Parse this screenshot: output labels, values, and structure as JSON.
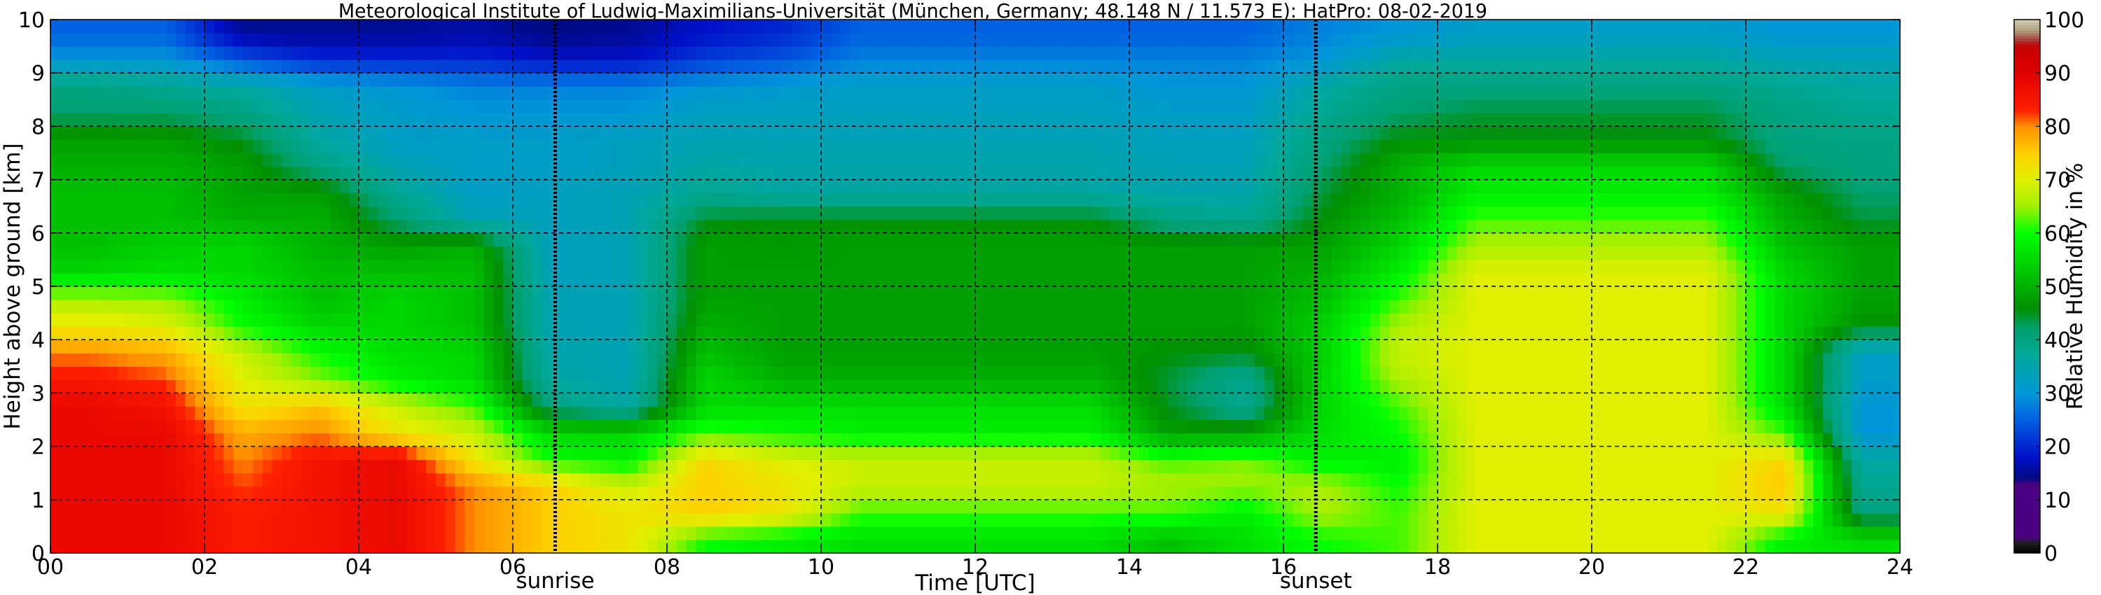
{
  "chart_data": {
    "type": "heatmap",
    "title": "Meteorological Institute of Ludwig-Maximilians-Universität (München, Germany; 48.148 N / 11.573 E):    HatPro: 08-02-2019",
    "xlabel": "Time [UTC]",
    "ylabel": "Height above ground [km]",
    "xlim": [
      0,
      24
    ],
    "ylim": [
      0,
      10
    ],
    "x_tick_labels": [
      "00",
      "02",
      "04",
      "06",
      "08",
      "10",
      "12",
      "14",
      "16",
      "18",
      "20",
      "22",
      "24"
    ],
    "y_tick_labels": [
      "0",
      "1",
      "2",
      "3",
      "4",
      "5",
      "6",
      "7",
      "8",
      "9",
      "10"
    ],
    "grid": true,
    "annotations": [
      {
        "text": "sunrise",
        "time": 6.55
      },
      {
        "text": "sunset",
        "time": 16.42
      }
    ],
    "colorbar": {
      "label": "Relative Humidity in %",
      "range": [
        0,
        100
      ],
      "tick_labels": [
        "0",
        "10",
        "20",
        "30",
        "40",
        "50",
        "60",
        "70",
        "80",
        "90",
        "100"
      ],
      "stops": [
        [
          0,
          "#000000"
        ],
        [
          2,
          "#202020"
        ],
        [
          3,
          "#4b0082"
        ],
        [
          13,
          "#4b0082"
        ],
        [
          14,
          "#000a80"
        ],
        [
          18,
          "#0010c8"
        ],
        [
          25,
          "#0060e0"
        ],
        [
          30,
          "#0098d8"
        ],
        [
          37,
          "#00a898"
        ],
        [
          42,
          "#00a070"
        ],
        [
          46,
          "#009000"
        ],
        [
          52,
          "#00c000"
        ],
        [
          60,
          "#00ff00"
        ],
        [
          65,
          "#a0f000"
        ],
        [
          70,
          "#e0f000"
        ],
        [
          75,
          "#ffd000"
        ],
        [
          80,
          "#ff9000"
        ],
        [
          83,
          "#ff2000"
        ],
        [
          90,
          "#e00000"
        ],
        [
          95,
          "#c80000"
        ],
        [
          96,
          "#a83030"
        ],
        [
          98,
          "#b0a080"
        ],
        [
          100,
          "#d0d0b0"
        ]
      ]
    },
    "time_centers_utc": [
      0.5,
      1.5,
      2.5,
      3.5,
      4.5,
      5.5,
      6.5,
      7.5,
      8.5,
      9.5,
      10.5,
      11.5,
      12.5,
      13.5,
      14.5,
      15.5,
      16.5,
      17.5,
      18.5,
      19.5,
      20.5,
      21.5,
      22.5,
      23.5
    ],
    "height_centers_km": [
      0.25,
      0.75,
      1.25,
      1.75,
      2.25,
      2.75,
      3.25,
      3.75,
      4.25,
      4.75,
      5.25,
      5.75,
      6.25,
      6.75,
      7.25,
      7.75,
      8.25,
      8.75,
      9.25,
      9.75
    ],
    "rh_profiles_percent": [
      [
        88,
        88,
        88,
        88,
        88,
        88,
        85,
        80,
        72,
        66,
        55,
        52,
        52,
        52,
        50,
        48,
        42,
        40,
        30,
        25
      ],
      [
        88,
        88,
        88,
        88,
        88,
        86,
        82,
        78,
        70,
        65,
        56,
        54,
        52,
        52,
        50,
        48,
        42,
        38,
        30,
        25
      ],
      [
        84,
        84,
        82,
        80,
        78,
        72,
        70,
        68,
        60,
        58,
        55,
        55,
        50,
        48,
        48,
        45,
        40,
        36,
        24,
        15
      ],
      [
        86,
        86,
        86,
        86,
        80,
        76,
        64,
        60,
        55,
        52,
        52,
        50,
        50,
        48,
        40,
        36,
        34,
        32,
        20,
        15
      ],
      [
        88,
        88,
        88,
        88,
        72,
        68,
        58,
        56,
        55,
        55,
        52,
        48,
        42,
        38,
        34,
        32,
        32,
        30,
        20,
        15
      ],
      [
        80,
        80,
        80,
        72,
        68,
        62,
        55,
        55,
        52,
        52,
        52,
        50,
        34,
        32,
        32,
        32,
        30,
        28,
        20,
        16
      ],
      [
        75,
        75,
        75,
        60,
        55,
        40,
        36,
        35,
        34,
        34,
        33,
        33,
        33,
        33,
        32,
        32,
        30,
        28,
        18,
        14
      ],
      [
        72,
        72,
        68,
        58,
        55,
        36,
        34,
        34,
        34,
        34,
        34,
        34,
        34,
        34,
        33,
        33,
        30,
        28,
        18,
        15
      ],
      [
        60,
        75,
        75,
        74,
        62,
        55,
        55,
        52,
        50,
        48,
        48,
        48,
        45,
        38,
        36,
        34,
        33,
        30,
        22,
        18
      ],
      [
        58,
        72,
        72,
        70,
        60,
        56,
        50,
        48,
        48,
        48,
        48,
        47,
        46,
        36,
        35,
        34,
        33,
        31,
        24,
        20
      ],
      [
        56,
        62,
        68,
        68,
        58,
        56,
        50,
        48,
        48,
        48,
        48,
        48,
        46,
        36,
        35,
        34,
        33,
        32,
        28,
        25
      ],
      [
        56,
        62,
        68,
        68,
        58,
        56,
        50,
        48,
        48,
        48,
        48,
        48,
        46,
        36,
        35,
        34,
        33,
        32,
        28,
        25
      ],
      [
        56,
        62,
        68,
        68,
        58,
        56,
        50,
        48,
        48,
        48,
        48,
        48,
        46,
        36,
        35,
        34,
        33,
        32,
        28,
        25
      ],
      [
        56,
        62,
        68,
        68,
        58,
        56,
        50,
        48,
        48,
        48,
        48,
        48,
        46,
        36,
        35,
        34,
        33,
        32,
        28,
        25
      ],
      [
        52,
        62,
        66,
        62,
        48,
        45,
        44,
        46,
        48,
        48,
        48,
        48,
        40,
        35,
        34,
        33,
        32,
        30,
        28,
        25
      ],
      [
        56,
        58,
        65,
        64,
        48,
        38,
        38,
        45,
        48,
        48,
        48,
        48,
        38,
        35,
        34,
        33,
        32,
        30,
        28,
        25
      ],
      [
        60,
        66,
        66,
        58,
        56,
        55,
        55,
        54,
        54,
        52,
        50,
        48,
        46,
        44,
        42,
        40,
        38,
        36,
        30,
        28
      ],
      [
        62,
        62,
        60,
        58,
        60,
        62,
        66,
        68,
        66,
        62,
        58,
        55,
        52,
        50,
        50,
        46,
        42,
        40,
        36,
        30
      ],
      [
        70,
        70,
        70,
        70,
        70,
        70,
        70,
        70,
        70,
        70,
        70,
        66,
        62,
        58,
        55,
        46,
        44,
        40,
        36,
        32
      ],
      [
        70,
        70,
        70,
        70,
        70,
        70,
        70,
        70,
        70,
        70,
        70,
        66,
        62,
        58,
        55,
        46,
        44,
        40,
        36,
        32
      ],
      [
        70,
        70,
        70,
        70,
        70,
        70,
        70,
        70,
        70,
        70,
        70,
        66,
        62,
        58,
        55,
        46,
        44,
        40,
        36,
        32
      ],
      [
        70,
        70,
        70,
        70,
        70,
        70,
        70,
        70,
        70,
        70,
        70,
        66,
        62,
        58,
        55,
        46,
        44,
        40,
        36,
        32
      ],
      [
        58,
        72,
        76,
        74,
        62,
        56,
        55,
        55,
        55,
        55,
        55,
        52,
        50,
        48,
        42,
        40,
        40,
        38,
        34,
        30
      ],
      [
        56,
        40,
        38,
        36,
        30,
        30,
        32,
        32,
        46,
        48,
        48,
        48,
        44,
        42,
        40,
        40,
        38,
        36,
        34,
        30
      ]
    ]
  }
}
